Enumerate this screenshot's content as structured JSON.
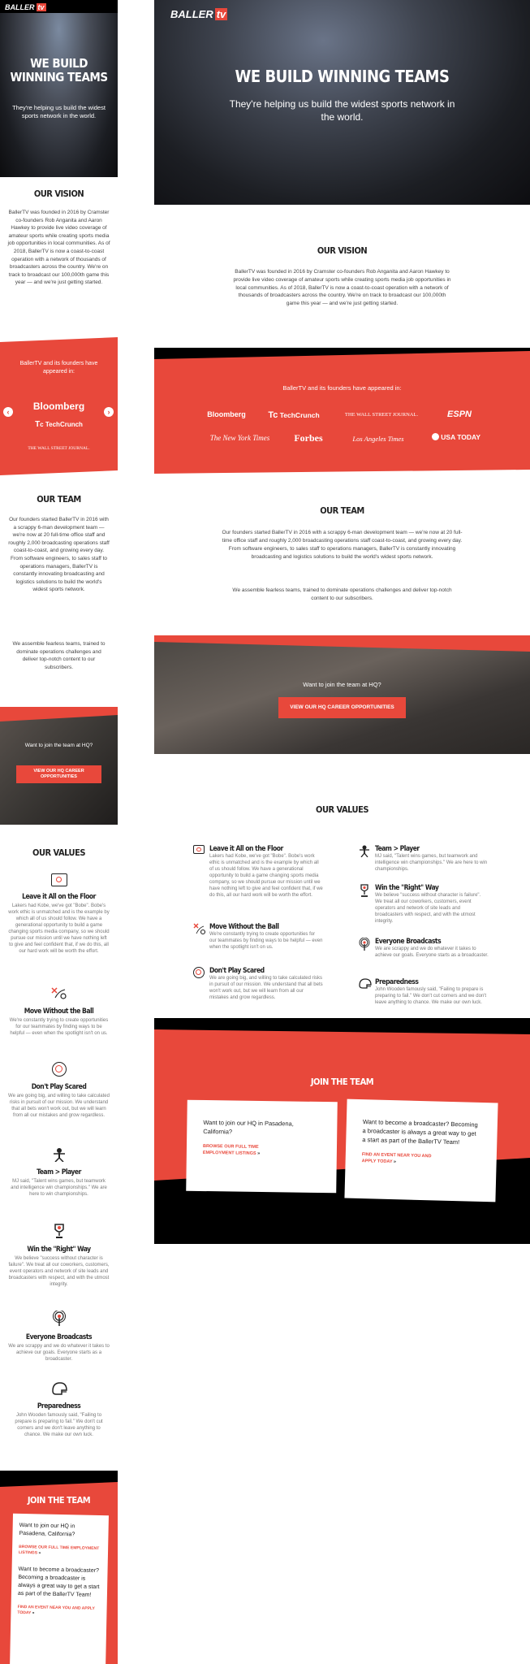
{
  "brand": {
    "name": "BALLER",
    "tv": "tv"
  },
  "hero": {
    "title": "WE BUILD WINNING TEAMS",
    "subtitle": "They're helping us build the widest sports network in the world."
  },
  "vision": {
    "heading": "OUR VISION",
    "body": "BallerTV was founded in 2016 by Cramster co-founders Rob Anganita and Aaron Hawkey to provide live video coverage of amateur sports while creating sports media job opportunities in local communities. As of 2018, BallerTV is now a coast-to-coast operation with a network of thousands of broadcasters across the country. We're on track to broadcast our 100,000th game this year — and we're just getting started."
  },
  "press": {
    "intro": "BallerTV and its founders have appeared in:",
    "logos": [
      "Bloomberg",
      "TechCrunch",
      "THE WALL STREET JOURNAL.",
      "ESPN",
      "The New York Times",
      "Forbes",
      "Los Angeles Times",
      "USA TODAY"
    ]
  },
  "team": {
    "heading": "OUR TEAM",
    "p1": "Our founders started BallerTV in 2016 with a scrappy 6-man development team — we're now at 20 full-time office staff and roughly 2,000 broadcasting operations staff coast-to-coast, and growing every day. From software engineers, to sales staff to operations managers, BallerTV is constantly innovating broadcasting and logistics solutions to build the world's widest sports network.",
    "p2": "We assemble fearless teams, trained to dominate operations challenges and deliver top-notch content to our subscribers."
  },
  "careers": {
    "prompt": "Want to join the team at HQ?",
    "button": "VIEW OUR HQ CAREER OPPORTUNITIES"
  },
  "values": {
    "heading": "OUR VALUES",
    "items": [
      {
        "icon": "tv-icon",
        "title": "Leave it All on the Floor",
        "body": "Lakers had Kobe, we've got \"Bobe\". Bobe's work ethic is unmatched and is the example by which all of us should follow. We have a generational opportunity to build a game changing sports media company, so we should pursue our mission until we have nothing left to give and feel confident that, if we do this, all our hard work will be worth the effort."
      },
      {
        "icon": "play-diagram-icon",
        "title": "Move Without the Ball",
        "body": "We're constantly trying to create opportunities for our teammates by finding ways to be helpful — even when the spotlight isn't on us."
      },
      {
        "icon": "basketball-icon",
        "title": "Don't Play Scared",
        "body": "We are going big, and willing to take calculated risks in pursuit of our mission. We understand that all bets won't work out, but we will learn from all our mistakes and grow regardless."
      },
      {
        "icon": "player-icon",
        "title": "Team > Player",
        "body": "MJ said, \"Talent wins games, but teamwork and intelligence win championships.\" We are here to win championships."
      },
      {
        "icon": "trophy-icon",
        "title": "Win the \"Right\" Way",
        "body": "We believe \"success without character is failure\". We treat all our coworkers, customers, event operators and network of site leads and broadcasters with respect, and with the utmost integrity."
      },
      {
        "icon": "broadcast-icon",
        "title": "Everyone Broadcasts",
        "body": "We are scrappy and we do whatever it takes to achieve our goals. Everyone starts as a broadcaster."
      },
      {
        "icon": "helmet-icon",
        "title": "Preparedness",
        "body": "John Wooden famously said, \"Failing to prepare is preparing to fail.\" We don't cut corners and we don't leave anything to chance. We make our own luck."
      }
    ]
  },
  "join": {
    "heading": "JOIN THE TEAM",
    "card1_text": "Want to join our HQ in Pasadena, California?",
    "card1_link": "BROWSE OUR FULL TIME EMPLOYMENT LISTINGS",
    "card2_text": "Want to become a broadcaster? Becoming a broadcaster is always a great way to get a start as part of the BallerTV Team!",
    "card2_link": "FIND AN EVENT NEAR YOU AND APPLY TODAY"
  },
  "colors": {
    "accent": "#e8483b",
    "dark": "#000000",
    "text": "#222222"
  }
}
